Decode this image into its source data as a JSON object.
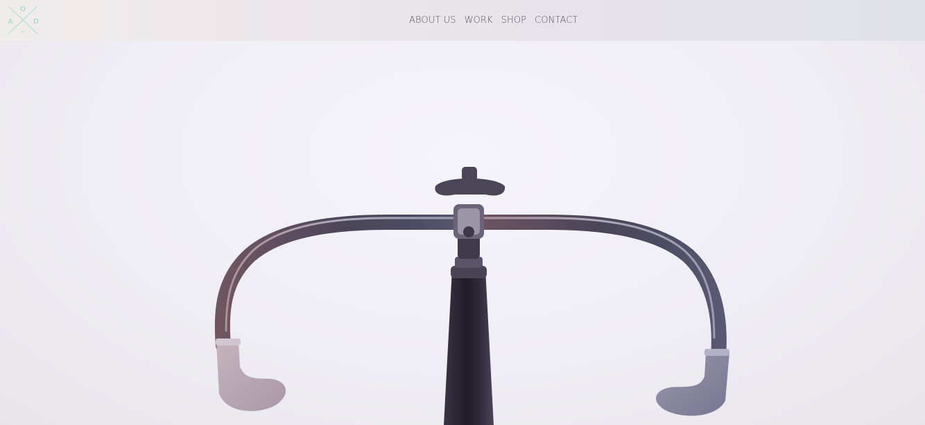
{
  "header": {
    "logo": {
      "letters": [
        "O",
        "A",
        "D"
      ],
      "small_text": "est.",
      "accent_color": "#8fd3c2"
    },
    "nav": {
      "items": [
        {
          "label": "ABOUT US"
        },
        {
          "label": "WORK"
        },
        {
          "label": "SHOP"
        },
        {
          "label": "CONTACT"
        }
      ]
    }
  },
  "hero": {
    "image": "bicycle-handlebar-photo"
  },
  "colors": {
    "nav_text": "#55555f",
    "logo_teal": "#8fd3c2",
    "background": "#f3f2f6"
  }
}
